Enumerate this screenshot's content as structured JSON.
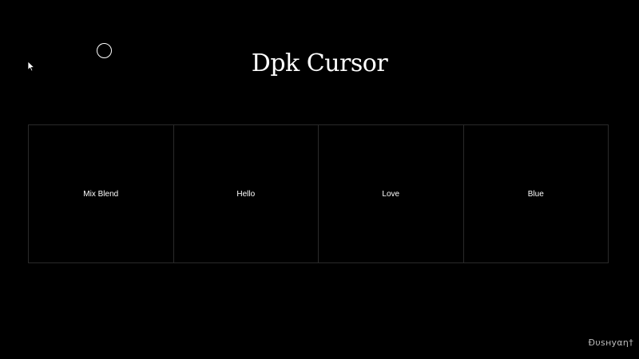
{
  "title": "Dpk Cursor",
  "boxes": [
    {
      "label": "Mix Blend"
    },
    {
      "label": "Hello"
    },
    {
      "label": "Love"
    },
    {
      "label": "Blue"
    }
  ],
  "watermark": "Ðυѕнуαη†",
  "colors": {
    "background": "#000000",
    "text": "#ffffff",
    "box_border": "#2a2a2a"
  },
  "icons": {
    "pointer": "arrow-pointer-icon",
    "cursor": "custom-circle-cursor-icon"
  }
}
